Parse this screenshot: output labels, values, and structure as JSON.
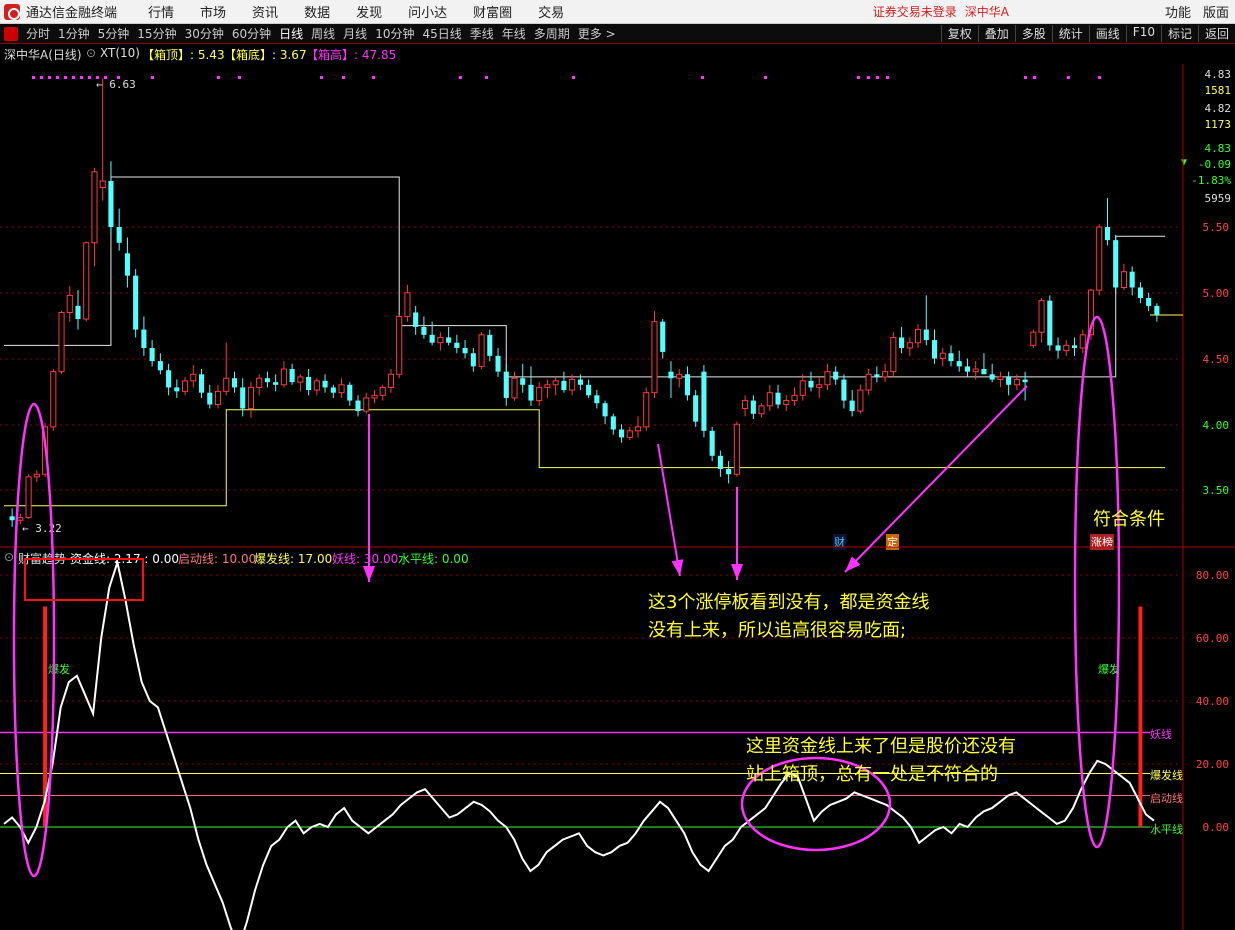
{
  "menubar": {
    "app_title": "通达信金融终端",
    "items": [
      "行情",
      "市场",
      "资讯",
      "数据",
      "发现",
      "问小达",
      "财富圈",
      "交易"
    ],
    "login_status": "证券交易未登录",
    "stock_name": "深中华A",
    "right_items": [
      "功能",
      "版面"
    ]
  },
  "toolbar": {
    "periods": [
      "分时",
      "1分钟",
      "5分钟",
      "15分钟",
      "30分钟",
      "60分钟",
      "日线",
      "周线",
      "月线",
      "10分钟",
      "45日线",
      "季线",
      "年线",
      "多周期",
      "更多 >"
    ],
    "active_period": "日线",
    "tools": [
      "复权",
      "叠加",
      "多股",
      "统计",
      "画线",
      "F10",
      "标记",
      "返回"
    ]
  },
  "main_panel": {
    "title": "深中华A(日线)",
    "indicator": "XT(10)",
    "box_top_label": "【箱顶】: 5.43",
    "box_bottom_label": "【箱底】: 3.67",
    "box_high_label": "【箱高】: 47.85"
  },
  "sub_panel": {
    "indicator_name": "财富趋势",
    "fund_line": "资金线: 2.17 : 0.00",
    "start_line": "启动线: 10.00",
    "burst_line": "爆发线: 17.00",
    "demon_line": "妖线: 30.00",
    "level_line": "水平线: 0.00"
  },
  "right_panel": {
    "values": [
      "4.83",
      "1581",
      "4.82",
      "1173",
      "4.83",
      "-0.09",
      "-1.83%",
      "5959"
    ],
    "price_ticks": [
      "5.50",
      "5.00",
      "4.50",
      "4.00",
      "3.50"
    ],
    "indicator_ticks": [
      "80.00",
      "60.00",
      "40.00",
      "20.00",
      "0.00"
    ],
    "line_labels": [
      "妖线",
      "爆发线",
      "启动线",
      "水平线"
    ]
  },
  "chart_markers": {
    "max_price": "6.63",
    "min_price": "3.22",
    "tag_finance": "财",
    "tag_fixed": "定",
    "tag_limit": "涨榜",
    "burst_left": "爆发",
    "burst_right": "爆发"
  },
  "annotations": {
    "condition_met": "符合条件",
    "note1_line1": "这3个涨停板看到没有，都是资金线",
    "note1_line2": "没有上来，所以追高很容易吃面;",
    "note2_line1": "这里资金线上来了但是股价还没有",
    "note2_line2": "站上箱顶，总有一处是不符合的"
  },
  "colors": {
    "up": "#ff3a3a",
    "down": "#54ffff",
    "magenta": "#ff33ff",
    "yellow": "#ffff55",
    "green": "#33ff33",
    "fund_line": "#ffffff",
    "grid": "#8b0000"
  },
  "chart_data": {
    "type": "candlestick",
    "price_axis": {
      "ticks": [
        5.5,
        5.0,
        4.5,
        4.0,
        3.5
      ]
    },
    "indicator_axis": {
      "ticks": [
        80,
        60,
        40,
        20,
        0
      ]
    },
    "candles": [
      [
        3.3,
        3.36,
        3.22,
        3.27
      ],
      [
        3.27,
        3.32,
        3.24,
        3.29
      ],
      [
        3.29,
        3.62,
        3.28,
        3.6
      ],
      [
        3.6,
        3.65,
        3.56,
        3.62
      ],
      [
        3.62,
        4.01,
        3.6,
        3.98
      ],
      [
        3.98,
        4.42,
        3.95,
        4.4
      ],
      [
        4.4,
        4.86,
        4.38,
        4.85
      ],
      [
        4.85,
        5.05,
        4.78,
        4.98
      ],
      [
        4.9,
        5.02,
        4.72,
        4.8
      ],
      [
        4.8,
        5.39,
        4.78,
        5.38
      ],
      [
        5.38,
        5.95,
        5.2,
        5.92
      ],
      [
        5.8,
        6.63,
        5.7,
        5.85
      ],
      [
        5.85,
        6.0,
        5.45,
        5.5
      ],
      [
        5.5,
        5.64,
        5.32,
        5.38
      ],
      [
        5.3,
        5.42,
        5.04,
        5.13
      ],
      [
        5.13,
        5.18,
        4.66,
        4.72
      ],
      [
        4.72,
        4.82,
        4.52,
        4.58
      ],
      [
        4.58,
        4.64,
        4.44,
        4.48
      ],
      [
        4.48,
        4.54,
        4.38,
        4.41
      ],
      [
        4.41,
        4.46,
        4.22,
        4.28
      ],
      [
        4.28,
        4.34,
        4.2,
        4.25
      ],
      [
        4.25,
        4.36,
        4.22,
        4.33
      ],
      [
        4.33,
        4.45,
        4.28,
        4.38
      ],
      [
        4.38,
        4.42,
        4.2,
        4.24
      ],
      [
        4.24,
        4.3,
        4.12,
        4.15
      ],
      [
        4.15,
        4.3,
        4.12,
        4.25
      ],
      [
        4.25,
        4.62,
        4.22,
        4.35
      ],
      [
        4.35,
        4.4,
        4.24,
        4.28
      ],
      [
        4.28,
        4.35,
        4.06,
        4.12
      ],
      [
        4.12,
        4.32,
        4.05,
        4.28
      ],
      [
        4.28,
        4.38,
        4.22,
        4.35
      ],
      [
        4.35,
        4.4,
        4.28,
        4.32
      ],
      [
        4.32,
        4.38,
        4.25,
        4.3
      ],
      [
        4.3,
        4.48,
        4.28,
        4.42
      ],
      [
        4.42,
        4.46,
        4.3,
        4.32
      ],
      [
        4.32,
        4.38,
        4.25,
        4.36
      ],
      [
        4.36,
        4.42,
        4.22,
        4.26
      ],
      [
        4.26,
        4.35,
        4.22,
        4.33
      ],
      [
        4.33,
        4.38,
        4.24,
        4.28
      ],
      [
        4.28,
        4.3,
        4.2,
        4.24
      ],
      [
        4.24,
        4.35,
        4.2,
        4.3
      ],
      [
        4.3,
        4.32,
        4.14,
        4.18
      ],
      [
        4.18,
        4.22,
        4.06,
        4.1
      ],
      [
        4.1,
        4.24,
        4.08,
        4.2
      ],
      [
        4.2,
        4.26,
        4.16,
        4.22
      ],
      [
        4.22,
        4.3,
        4.18,
        4.28
      ],
      [
        4.28,
        4.42,
        4.24,
        4.38
      ],
      [
        4.38,
        4.83,
        4.35,
        4.82
      ],
      [
        4.82,
        5.06,
        4.78,
        5.0
      ],
      [
        4.85,
        4.9,
        4.68,
        4.74
      ],
      [
        4.74,
        4.82,
        4.65,
        4.68
      ],
      [
        4.68,
        4.78,
        4.6,
        4.62
      ],
      [
        4.62,
        4.7,
        4.56,
        4.66
      ],
      [
        4.66,
        4.74,
        4.6,
        4.62
      ],
      [
        4.62,
        4.68,
        4.54,
        4.58
      ],
      [
        4.58,
        4.64,
        4.5,
        4.54
      ],
      [
        4.54,
        4.58,
        4.4,
        4.44
      ],
      [
        4.44,
        4.7,
        4.42,
        4.68
      ],
      [
        4.68,
        4.72,
        4.48,
        4.52
      ],
      [
        4.52,
        4.58,
        4.36,
        4.4
      ],
      [
        4.4,
        4.46,
        4.14,
        4.2
      ],
      [
        4.2,
        4.4,
        4.18,
        4.35
      ],
      [
        4.35,
        4.46,
        4.24,
        4.3
      ],
      [
        4.3,
        4.44,
        4.14,
        4.18
      ],
      [
        4.18,
        4.32,
        4.14,
        4.28
      ],
      [
        4.28,
        4.34,
        4.2,
        4.3
      ],
      [
        4.3,
        4.36,
        4.22,
        4.33
      ],
      [
        4.33,
        4.4,
        4.24,
        4.26
      ],
      [
        4.26,
        4.38,
        4.22,
        4.34
      ],
      [
        4.34,
        4.38,
        4.26,
        4.3
      ],
      [
        4.3,
        4.34,
        4.2,
        4.22
      ],
      [
        4.22,
        4.26,
        4.12,
        4.16
      ],
      [
        4.16,
        4.18,
        4.0,
        4.06
      ],
      [
        4.06,
        4.08,
        3.92,
        3.96
      ],
      [
        3.96,
        4.0,
        3.86,
        3.9
      ],
      [
        3.9,
        3.98,
        3.88,
        3.95
      ],
      [
        3.95,
        4.06,
        3.9,
        3.98
      ],
      [
        3.98,
        4.28,
        3.95,
        4.24
      ],
      [
        4.24,
        4.86,
        4.2,
        4.78
      ],
      [
        4.78,
        4.8,
        4.5,
        4.55
      ],
      [
        4.4,
        4.48,
        4.2,
        4.35
      ],
      [
        4.35,
        4.42,
        4.28,
        4.38
      ],
      [
        4.38,
        4.44,
        4.18,
        4.22
      ],
      [
        4.22,
        4.26,
        3.98,
        4.02
      ],
      [
        4.4,
        4.45,
        3.9,
        3.95
      ],
      [
        3.95,
        3.98,
        3.72,
        3.76
      ],
      [
        3.76,
        3.8,
        3.6,
        3.66
      ],
      [
        3.66,
        3.72,
        3.55,
        3.62
      ],
      [
        3.62,
        4.02,
        3.6,
        4.0
      ],
      [
        4.12,
        4.22,
        4.06,
        4.18
      ],
      [
        4.18,
        4.22,
        4.04,
        4.08
      ],
      [
        4.08,
        4.16,
        4.05,
        4.14
      ],
      [
        4.14,
        4.3,
        4.1,
        4.24
      ],
      [
        4.24,
        4.3,
        4.12,
        4.15
      ],
      [
        4.15,
        4.22,
        4.1,
        4.18
      ],
      [
        4.18,
        4.28,
        4.14,
        4.22
      ],
      [
        4.22,
        4.38,
        4.18,
        4.33
      ],
      [
        4.33,
        4.4,
        4.25,
        4.28
      ],
      [
        4.28,
        4.36,
        4.2,
        4.3
      ],
      [
        4.3,
        4.46,
        4.26,
        4.4
      ],
      [
        4.4,
        4.44,
        4.3,
        4.34
      ],
      [
        4.34,
        4.38,
        4.12,
        4.18
      ],
      [
        4.18,
        4.26,
        4.06,
        4.1
      ],
      [
        4.1,
        4.3,
        4.08,
        4.26
      ],
      [
        4.26,
        4.42,
        4.22,
        4.38
      ],
      [
        4.38,
        4.44,
        4.32,
        4.36
      ],
      [
        4.36,
        4.46,
        4.32,
        4.4
      ],
      [
        4.4,
        4.7,
        4.36,
        4.66
      ],
      [
        4.66,
        4.74,
        4.54,
        4.58
      ],
      [
        4.58,
        4.66,
        4.52,
        4.62
      ],
      [
        4.62,
        4.76,
        4.58,
        4.72
      ],
      [
        4.72,
        4.98,
        4.6,
        4.64
      ],
      [
        4.64,
        4.72,
        4.46,
        4.5
      ],
      [
        4.5,
        4.58,
        4.44,
        4.54
      ],
      [
        4.54,
        4.6,
        4.44,
        4.48
      ],
      [
        4.48,
        4.56,
        4.4,
        4.44
      ],
      [
        4.44,
        4.5,
        4.36,
        4.4
      ],
      [
        4.4,
        4.48,
        4.34,
        4.42
      ],
      [
        4.42,
        4.54,
        4.4,
        4.38
      ],
      [
        4.38,
        4.46,
        4.32,
        4.34
      ],
      [
        4.34,
        4.4,
        4.28,
        4.36
      ],
      [
        4.36,
        4.4,
        4.22,
        4.3
      ],
      [
        4.3,
        4.38,
        4.26,
        4.34
      ],
      [
        4.34,
        4.4,
        4.18,
        4.32
      ],
      [
        4.6,
        4.72,
        4.58,
        4.7
      ],
      [
        4.7,
        4.96,
        4.62,
        4.94
      ],
      [
        4.94,
        4.98,
        4.56,
        4.6
      ],
      [
        4.6,
        4.66,
        4.5,
        4.56
      ],
      [
        4.56,
        4.64,
        4.52,
        4.6
      ],
      [
        4.6,
        4.66,
        4.52,
        4.58
      ],
      [
        4.58,
        4.72,
        4.54,
        4.68
      ],
      [
        4.68,
        5.03,
        4.64,
        5.02
      ],
      [
        5.02,
        5.52,
        4.98,
        5.5
      ],
      [
        5.5,
        5.72,
        5.36,
        5.4
      ],
      [
        5.4,
        5.44,
        5.0,
        5.04
      ],
      [
        5.04,
        5.22,
        5.02,
        5.16
      ],
      [
        5.16,
        5.2,
        4.98,
        5.04
      ],
      [
        5.04,
        5.08,
        4.92,
        4.96
      ],
      [
        4.96,
        5.0,
        4.86,
        4.9
      ],
      [
        4.9,
        4.92,
        4.78,
        4.83
      ]
    ],
    "fund_line": [
      1,
      3,
      0,
      -5,
      0,
      8,
      20,
      38,
      46,
      48,
      42,
      36,
      60,
      76,
      84,
      72,
      58,
      46,
      40,
      38,
      30,
      22,
      14,
      6,
      -4,
      -12,
      -18,
      -24,
      -32,
      -38,
      -30,
      -20,
      -12,
      -6,
      -4,
      0,
      2,
      -2,
      0,
      1,
      0,
      4,
      6,
      2,
      0,
      -2,
      0,
      2,
      4,
      7,
      9,
      11,
      12,
      9,
      6,
      3,
      4,
      6,
      8,
      7,
      5,
      2,
      0,
      -4,
      -10,
      -14,
      -12,
      -8,
      -6,
      -4,
      -3,
      -2,
      -6,
      -8,
      -9,
      -8,
      -6,
      -5,
      -2,
      2,
      5,
      8,
      6,
      2,
      -2,
      -8,
      -12,
      -14,
      -10,
      -6,
      -4,
      0,
      2,
      4,
      6,
      10,
      14,
      17,
      16,
      9,
      2,
      5,
      7,
      8,
      9,
      11,
      10,
      9,
      8,
      7,
      5,
      3,
      0,
      -5,
      -3,
      -1,
      0,
      -2,
      1,
      0,
      3,
      5,
      6,
      8,
      10,
      11,
      9,
      7,
      5,
      3,
      1,
      2,
      6,
      12,
      17,
      21,
      20,
      18,
      16,
      14,
      9,
      4,
      2
    ],
    "columns": [
      {
        "index": 4,
        "start": 0,
        "end": 70,
        "color": "red"
      },
      {
        "index": 137,
        "start": 0,
        "end": 70,
        "color": "red"
      }
    ],
    "box_lines": {
      "white": [
        [
          0,
          12,
          4.6
        ],
        [
          12,
          47,
          5.88
        ],
        [
          47,
          60,
          4.75
        ],
        [
          60,
          77,
          4.36
        ],
        [
          77,
          134,
          4.36
        ],
        [
          134,
          140,
          5.43
        ]
      ],
      "yellow": [
        [
          0,
          26,
          3.38
        ],
        [
          26,
          64,
          4.11
        ],
        [
          64,
          89,
          3.67
        ],
        [
          89,
          140,
          3.67
        ]
      ]
    },
    "threshold_lines": {
      "demon": 30,
      "burst": 17,
      "start": 10,
      "level": 0
    }
  }
}
